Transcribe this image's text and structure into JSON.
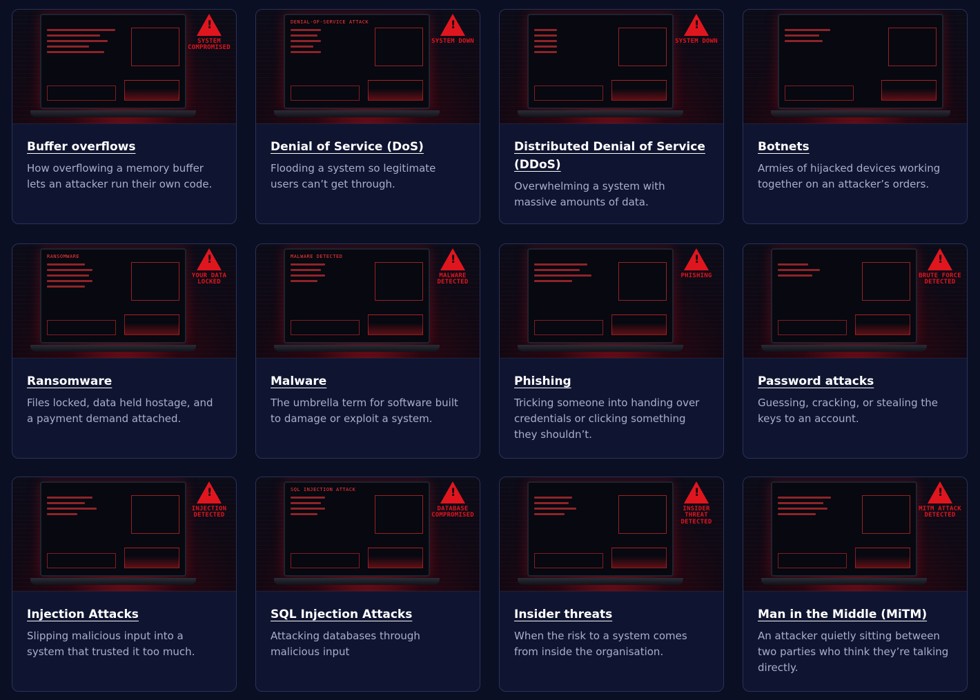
{
  "cards": [
    {
      "title": "Buffer overflows",
      "desc": "How overflowing a memory buffer lets an attacker run their own code.",
      "screen_label": "",
      "warning": "SYSTEM COMPROMISED"
    },
    {
      "title": "Denial of Service (DoS)",
      "desc": "Flooding a system so legitimate users can’t get through.",
      "screen_label": "DENIAL-OF-SERVICE ATTACK",
      "warning": "SYSTEM DOWN"
    },
    {
      "title": "Distributed Denial of Service (DDoS)",
      "desc": "Overwhelming a system with massive amounts of data.",
      "screen_label": "",
      "warning": "SYSTEM DOWN"
    },
    {
      "title": "Botnets",
      "desc": "Armies of hijacked devices working together on an attacker’s orders.",
      "screen_label": "",
      "warning": ""
    },
    {
      "title": "Ransomware",
      "desc": "Files locked, data held hostage, and a payment demand attached.",
      "screen_label": "RANSOMWARE",
      "warning": "YOUR DATA LOCKED"
    },
    {
      "title": "Malware",
      "desc": "The umbrella term for software built to damage or exploit a system.",
      "screen_label": "MALWARE DETECTED",
      "warning": "MALWARE DETECTED"
    },
    {
      "title": "Phishing",
      "desc": "Tricking someone into handing over credentials or clicking something they shouldn’t.",
      "screen_label": "",
      "warning": "PHISHING"
    },
    {
      "title": "Password attacks",
      "desc": "Guessing, cracking, or stealing the keys to an account.",
      "screen_label": "",
      "warning": "BRUTE FORCE DETECTED"
    },
    {
      "title": "Injection Attacks",
      "desc": "Slipping malicious input into a system that trusted it too much.",
      "screen_label": "",
      "warning": "INJECTION DETECTED"
    },
    {
      "title": "SQL Injection Attacks",
      "desc": "Attacking databases through malicious input",
      "screen_label": "SQL INJECTION ATTACK",
      "warning": "DATABASE COMPROMISED"
    },
    {
      "title": "Insider threats",
      "desc": "When the risk to a system comes from inside the organisation.",
      "screen_label": "",
      "warning": "INSIDER THREAT DETECTED"
    },
    {
      "title": "Man in the Middle (MiTM)",
      "desc": "An attacker quietly sitting between two parties who think they’re talking directly.",
      "screen_label": "",
      "warning": "MITM ATTACK DETECTED"
    }
  ]
}
